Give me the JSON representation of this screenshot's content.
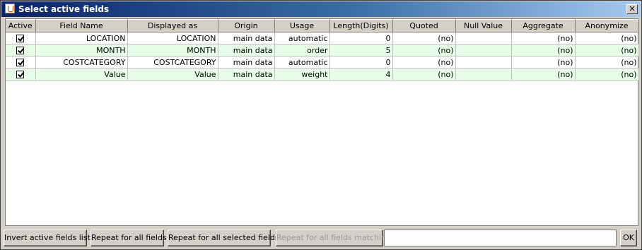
{
  "window": {
    "title": "Select active fields",
    "close_symbol": "✕"
  },
  "table": {
    "columns": [
      "Active",
      "Field Name",
      "Displayed as",
      "Origin",
      "Usage",
      "Length(Digits)",
      "Quoted",
      "Null Value",
      "Aggregate",
      "Anonymize"
    ],
    "rows": [
      {
        "active": true,
        "field_name": "LOCATION",
        "displayed_as": "LOCATION",
        "origin": "main data",
        "usage": "automatic",
        "length": "0",
        "quoted": "(no)",
        "null_value": "",
        "aggregate": "(no)",
        "anonymize": "(no)"
      },
      {
        "active": true,
        "field_name": "MONTH",
        "displayed_as": "MONTH",
        "origin": "main data",
        "usage": "order",
        "length": "5",
        "quoted": "(no)",
        "null_value": "",
        "aggregate": "(no)",
        "anonymize": "(no)"
      },
      {
        "active": true,
        "field_name": "COSTCATEGORY",
        "displayed_as": "COSTCATEGORY",
        "origin": "main data",
        "usage": "automatic",
        "length": "0",
        "quoted": "(no)",
        "null_value": "",
        "aggregate": "(no)",
        "anonymize": "(no)"
      },
      {
        "active": true,
        "field_name": "Value",
        "displayed_as": "Value",
        "origin": "main data",
        "usage": "weight",
        "length": "4",
        "quoted": "(no)",
        "null_value": "",
        "aggregate": "(no)",
        "anonymize": "(no)"
      }
    ]
  },
  "buttons": {
    "invert": "Invert active fields list",
    "repeat_all": "Repeat for all fields",
    "repeat_selected": "Repeat for all selected fields",
    "repeat_matching": "Repeat for all fields matching:",
    "ok": "OK"
  },
  "match_input": {
    "value": ""
  }
}
